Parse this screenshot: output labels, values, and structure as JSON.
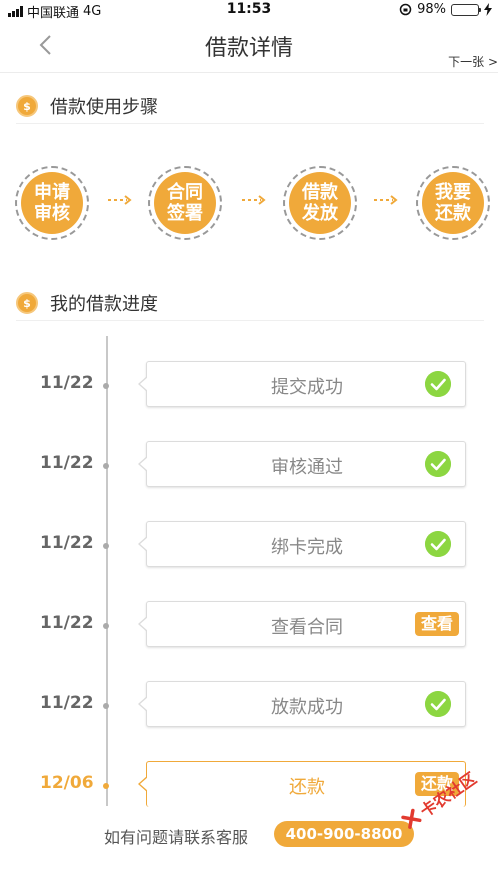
{
  "status_bar": {
    "carrier": "中国联通",
    "network": "4G",
    "time": "11:53",
    "battery": "98%",
    "battery_level": 0.98,
    "icons": [
      "signal-icon",
      "orientation-lock-icon",
      "battery-icon",
      "charging-icon"
    ]
  },
  "nav": {
    "title": "借款详情",
    "next": "下一张 >",
    "icons": [
      "back-chevron-icon"
    ]
  },
  "steps_section": {
    "title": "借款使用步骤",
    "steps": [
      {
        "line1": "申请",
        "line2": "审核"
      },
      {
        "line1": "合同",
        "line2": "签署"
      },
      {
        "line1": "借款",
        "line2": "发放"
      },
      {
        "line1": "我要",
        "line2": "还款"
      }
    ]
  },
  "progress_section": {
    "title": "我的借款进度",
    "items": [
      {
        "date": "11/22",
        "label": "提交成功",
        "status": "check"
      },
      {
        "date": "11/22",
        "label": "审核通过",
        "status": "check"
      },
      {
        "date": "11/22",
        "label": "绑卡完成",
        "status": "check"
      },
      {
        "date": "11/22",
        "label": "查看合同",
        "action": "查看"
      },
      {
        "date": "11/22",
        "label": "放款成功",
        "status": "check"
      },
      {
        "date": "12/06",
        "label": "还款",
        "action": "还款",
        "active": true
      }
    ]
  },
  "footer": {
    "text": "如有问题请联系客服",
    "phone": "400-900-8800"
  },
  "watermark": {
    "text": "卡农社区"
  },
  "colors": {
    "accent": "#f0a93a",
    "success": "#8cd641",
    "text": "#333333",
    "muted": "#888888"
  }
}
